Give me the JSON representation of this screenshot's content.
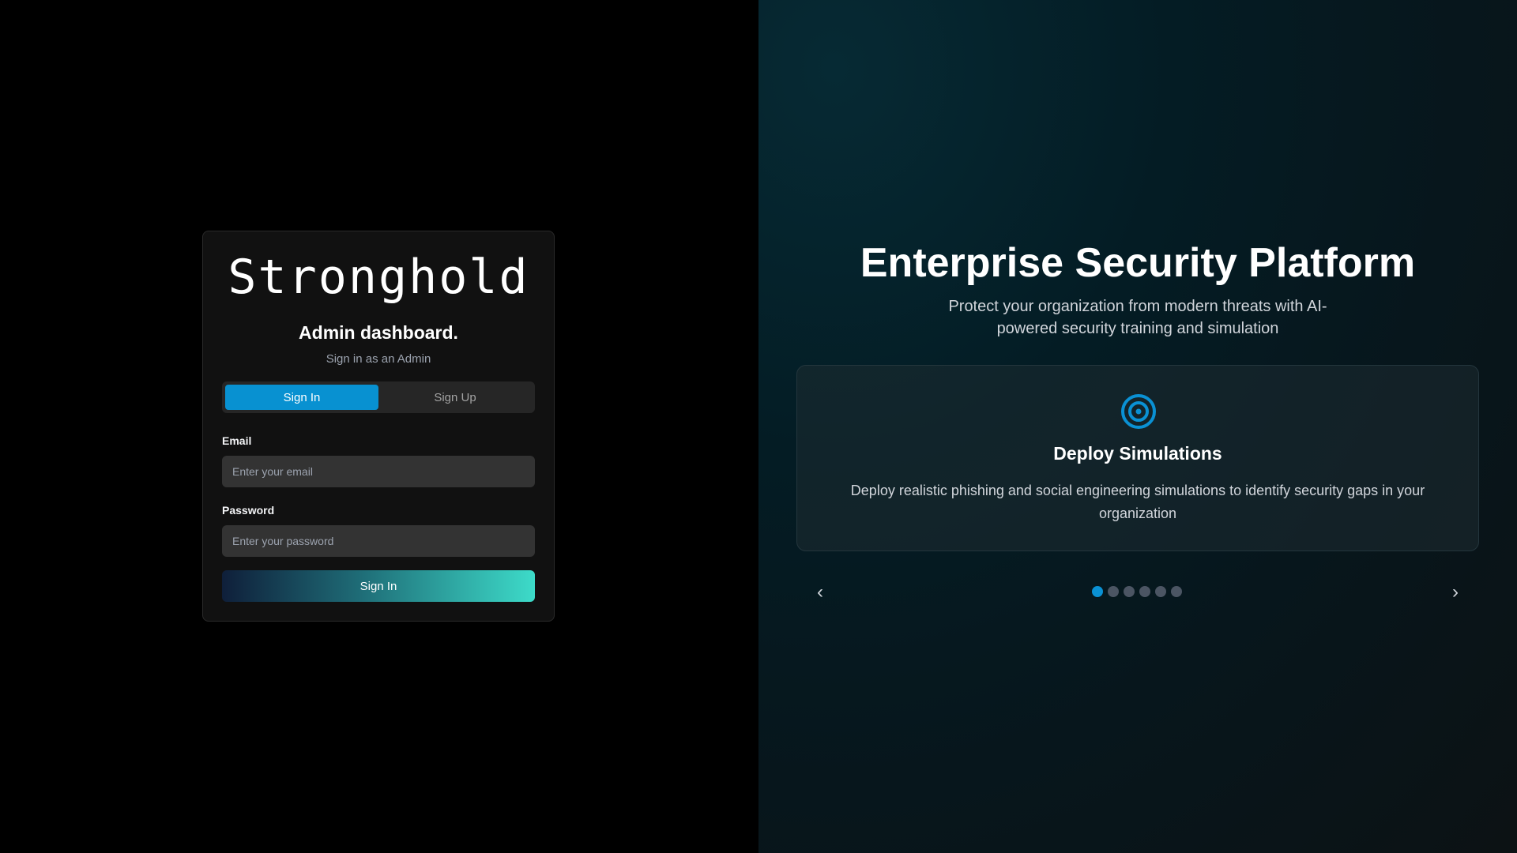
{
  "login": {
    "logo": "Stronghold",
    "title": "Admin dashboard.",
    "subtitle": "Sign in as an Admin",
    "tabs": [
      {
        "label": "Sign In",
        "active": true
      },
      {
        "label": "Sign Up",
        "active": false
      }
    ],
    "email": {
      "label": "Email",
      "placeholder": "Enter your email",
      "value": ""
    },
    "password": {
      "label": "Password",
      "placeholder": "Enter your password",
      "value": ""
    },
    "submit_label": "Sign In"
  },
  "hero": {
    "title": "Enterprise Security Platform",
    "subtitle": "Protect your organization from modern threats with AI-powered security training and simulation"
  },
  "carousel": {
    "current_index": 0,
    "total_slides": 6,
    "slide": {
      "icon": "target-icon",
      "title": "Deploy Simulations",
      "description": "Deploy realistic phishing and social engineering simulations to identify security gaps in your organization"
    },
    "prev_icon": "chevron-left-icon",
    "next_icon": "chevron-right-icon",
    "prev_glyph": "‹",
    "next_glyph": "›"
  },
  "colors": {
    "accent": "#0891d1",
    "gradient_start": "#0f1f3a",
    "gradient_end": "#3ddbc9"
  }
}
